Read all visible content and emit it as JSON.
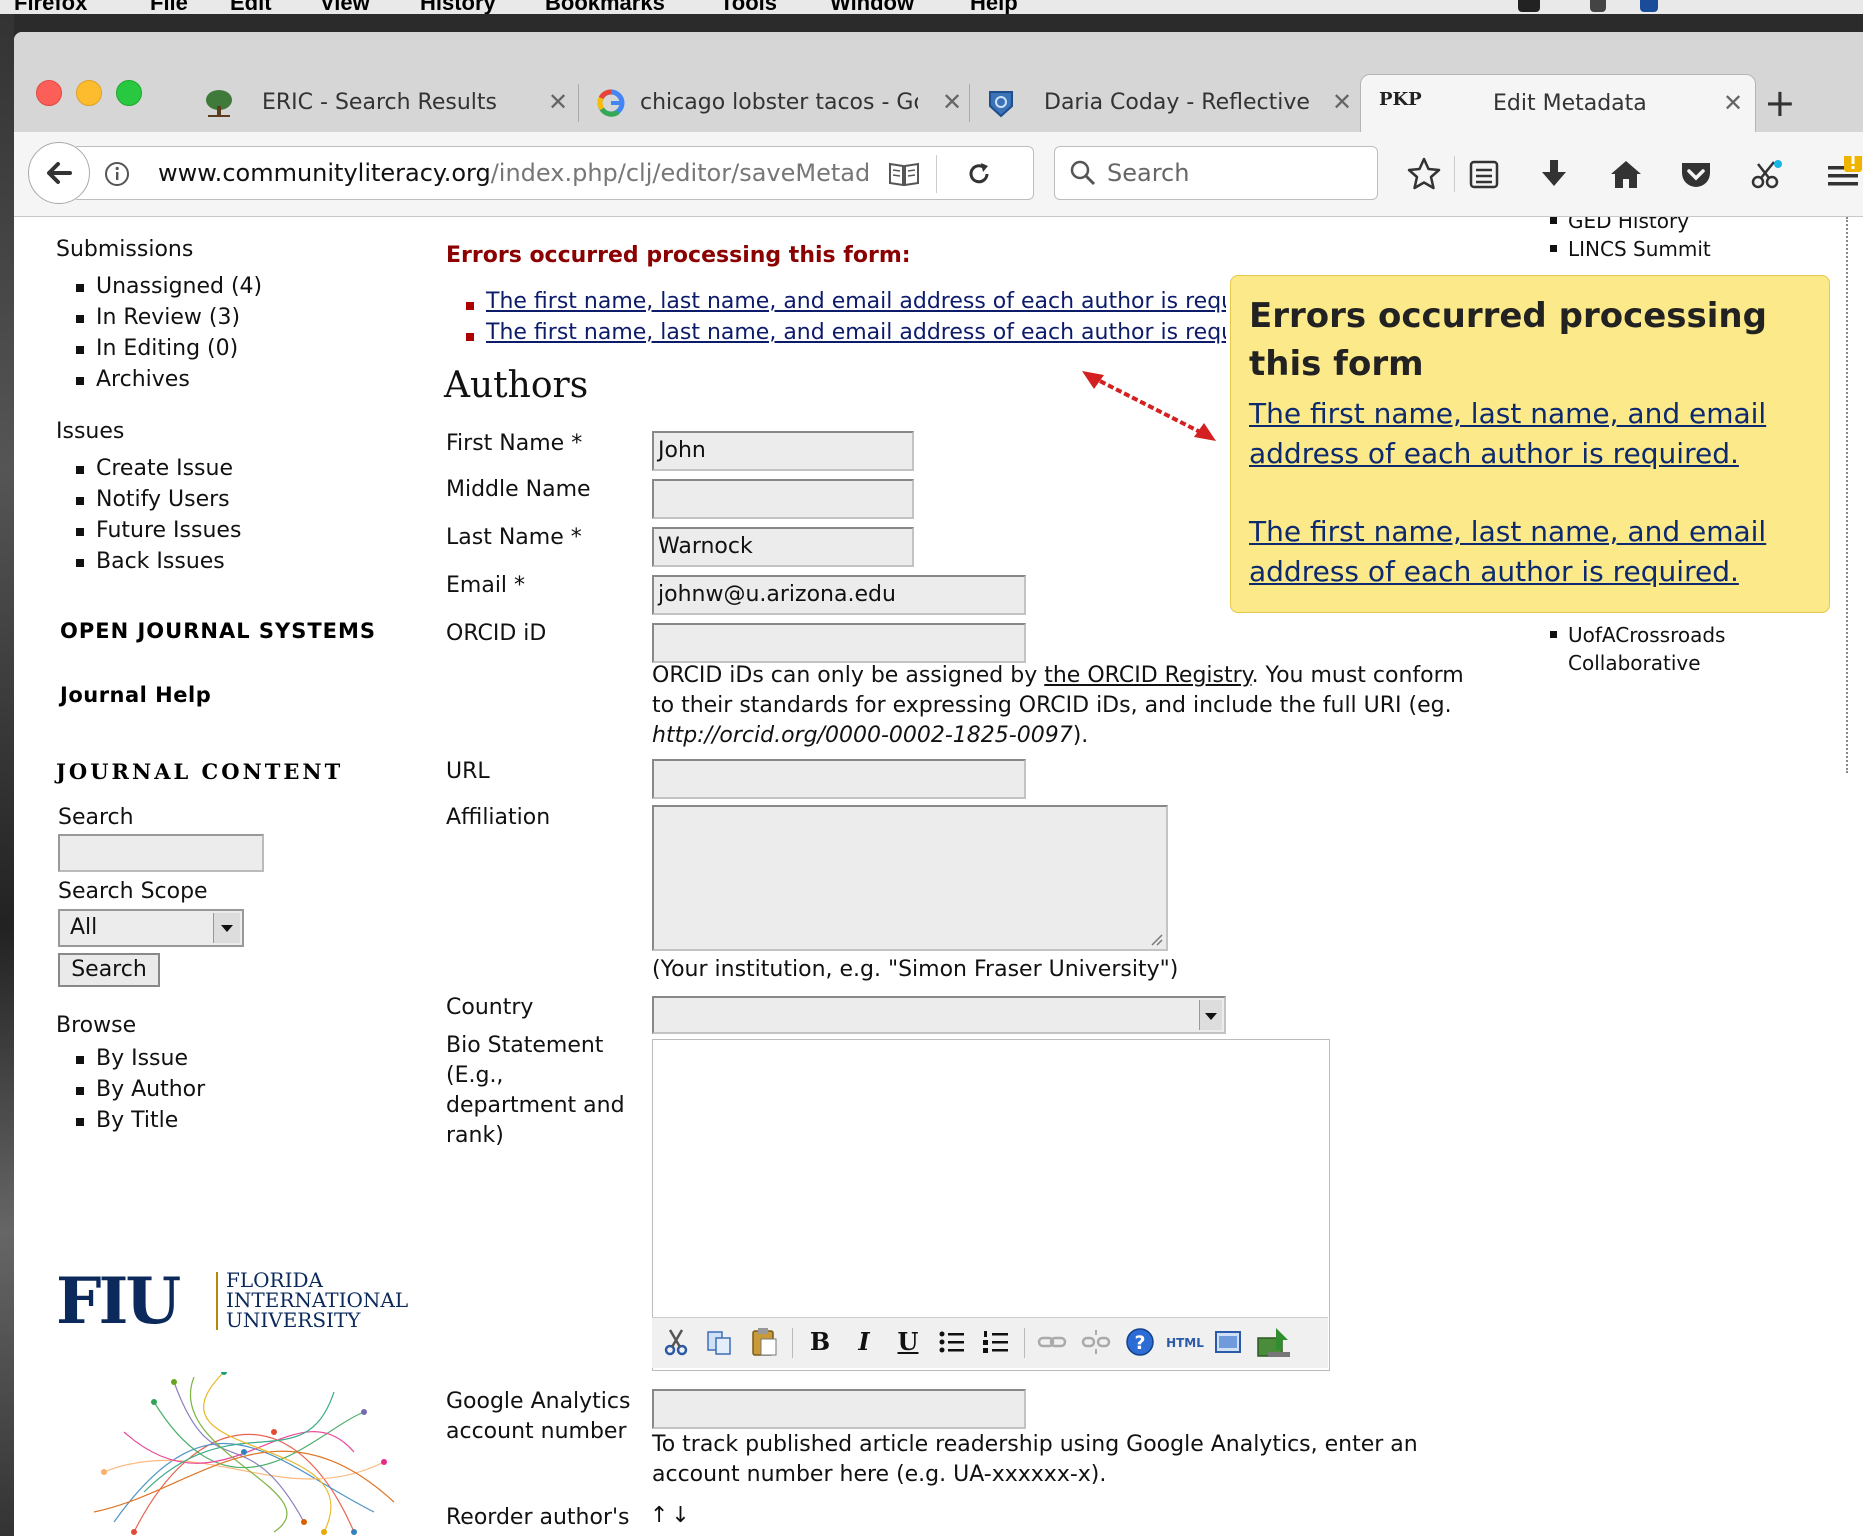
{
  "menubar": {
    "items": [
      "Firefox",
      "File",
      "Edit",
      "View",
      "History",
      "Bookmarks",
      "Tools",
      "Window",
      "Help"
    ]
  },
  "tabs": [
    {
      "title": "ERIC - Search Results",
      "icon": "tree-icon"
    },
    {
      "title": "chicago lobster tacos - Go",
      "icon": "google-g-icon"
    },
    {
      "title": "Daria Coday - Reflective Po",
      "icon": "shield-logo-icon"
    },
    {
      "title": "Edit Metadata",
      "icon": "pkp-icon",
      "icon_text": "PKP",
      "active": true
    }
  ],
  "navbar": {
    "url_host": "www.communityliteracy.org",
    "url_path": "/index.php/clj/editor/saveMetadata",
    "search_placeholder": "Search"
  },
  "sidebar": {
    "submissions_heading": "Submissions",
    "submissions": [
      "Unassigned (4)",
      "In Review (3)",
      "In Editing (0)",
      "Archives"
    ],
    "issues_heading": "Issues",
    "issues": [
      "Create Issue",
      "Notify Users",
      "Future Issues",
      "Back Issues"
    ],
    "ojs": "OPEN JOURNAL SYSTEMS",
    "journal_help": "Journal Help",
    "journal_content": "JOURNAL CONTENT",
    "search_label": "Search",
    "search_scope_label": "Search Scope",
    "search_scope_value": "All",
    "search_button": "Search",
    "browse_heading": "Browse",
    "browse": [
      "By Issue",
      "By Author",
      "By Title"
    ],
    "logo_abbrev": "FIU",
    "logo_lines": [
      "FLORIDA",
      "INTERNATIONAL",
      "UNIVERSITY"
    ]
  },
  "errors": {
    "heading": "Errors occurred processing this form:",
    "items": [
      "The first name, last name, and email address of each author is required.",
      "The first name, last name, and email address of each author is required."
    ]
  },
  "tooltip": {
    "title": "Errors occurred processing this form",
    "links": [
      "The first name, last name, and email address of each author is required.",
      "The first name, last name, and email address of each author is required."
    ]
  },
  "right_sidebar": {
    "top_items": [
      "GED History",
      "LINCS Summit"
    ],
    "bottom_item": "UofACrossroads Collaborative"
  },
  "form": {
    "heading": "Authors",
    "first_name_label": "First Name *",
    "first_name_value": "John",
    "middle_name_label": "Middle Name",
    "middle_name_value": "",
    "last_name_label": "Last Name *",
    "last_name_value": "Warnock",
    "email_label": "Email *",
    "email_value": "johnw@u.arizona.edu",
    "orcid_label": "ORCID iD",
    "orcid_value": "",
    "orcid_help_1": "ORCID iDs can only be assigned by ",
    "orcid_help_link": "the ORCID Registry",
    "orcid_help_2": ". You must conform to their standards for expressing ORCID iDs, and include the full URI (eg. ",
    "orcid_help_example": "http://orcid.org/0000-0002-1825-0097",
    "orcid_help_3": ").",
    "url_label": "URL",
    "affiliation_label": "Affiliation",
    "affiliation_help": "(Your institution, e.g. \"Simon Fraser University\")",
    "country_label": "Country",
    "bio_label": "Bio Statement (E.g., department and rank)",
    "ga_label": "Google Analytics account number",
    "ga_help": "To track published article readership using Google Analytics, enter an account number here (e.g. UA-xxxxxx-x).",
    "reorder_label": "Reorder author's name",
    "reorder_arrows": "↑↓"
  },
  "colors": {
    "error_red": "#8b0000",
    "tooltip_bg": "#fbe98a",
    "link_blue": "#0d1b6b",
    "arrow_red": "#d42020"
  }
}
